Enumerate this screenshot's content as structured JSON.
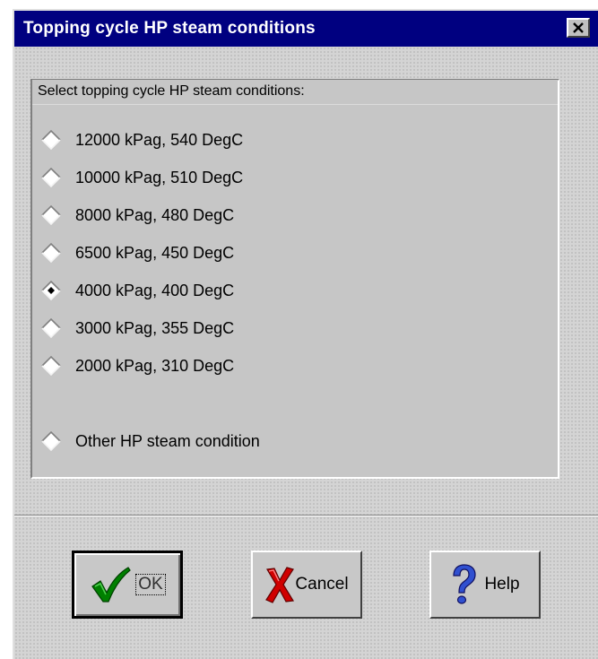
{
  "window": {
    "title": "Topping cycle HP steam conditions",
    "close_icon": "close-x-icon"
  },
  "group": {
    "label": "Select topping cycle HP steam conditions:",
    "selected_index": 4,
    "options": [
      "12000 kPag, 540 DegC",
      "10000 kPag, 510 DegC",
      "8000 kPag, 480 DegC",
      "6500 kPag, 450 DegC",
      "4000 kPag, 400 DegC",
      "3000 kPag, 355 DegC",
      "2000 kPag, 310 DegC",
      "Other HP steam condition"
    ]
  },
  "buttons": {
    "ok": {
      "label": "OK",
      "icon": "checkmark-icon",
      "default": true
    },
    "cancel": {
      "label": "Cancel",
      "icon": "red-x-icon"
    },
    "help": {
      "label": "Help",
      "icon": "question-mark-icon"
    }
  },
  "colors": {
    "titlebar": "#000080",
    "check_green": "#008000",
    "cancel_red": "#d00000",
    "help_blue": "#3050d0"
  }
}
